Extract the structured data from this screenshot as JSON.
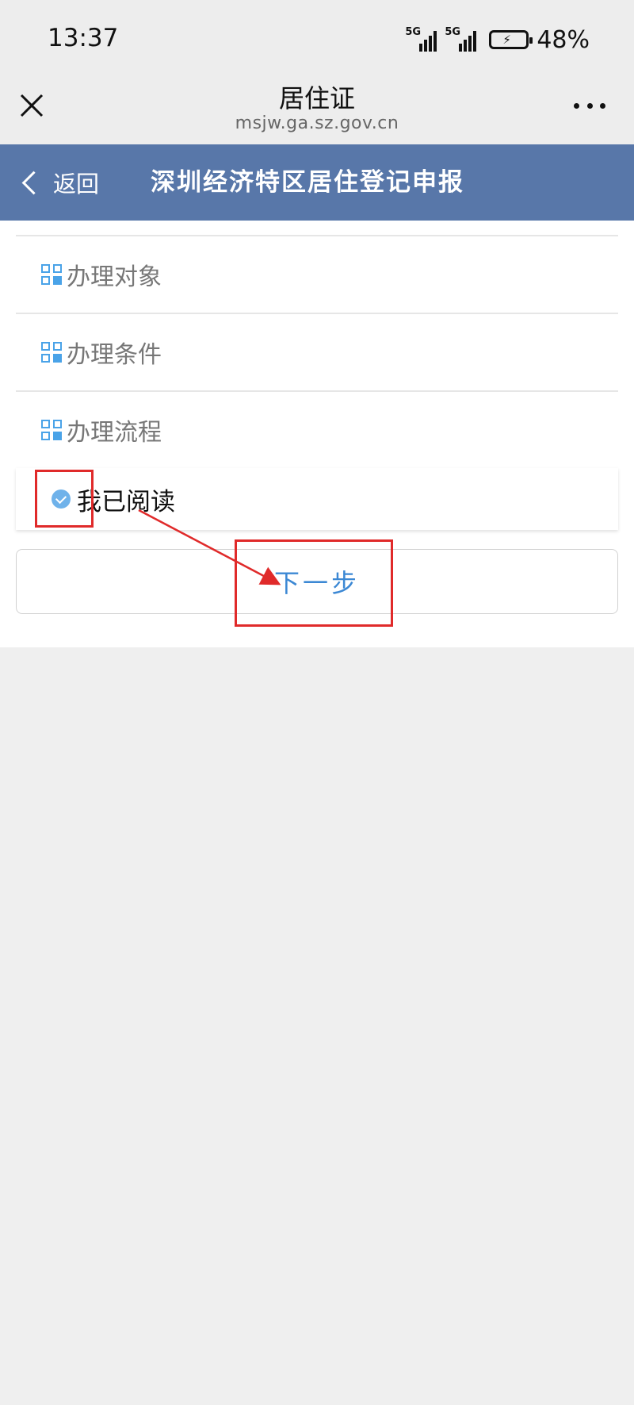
{
  "status_bar": {
    "time": "13:37",
    "signal1_label": "5G",
    "signal2_label": "5G",
    "battery_percent": "48%"
  },
  "title_bar": {
    "title": "居住证",
    "subtitle": "msjw.ga.sz.gov.cn"
  },
  "header": {
    "back_label": "返回",
    "title": "深圳经济特区居住登记申报"
  },
  "sections": [
    {
      "label": "办理对象"
    },
    {
      "label": "办理条件"
    },
    {
      "label": "办理流程"
    }
  ],
  "agreement": {
    "label": "我已阅读",
    "checked": true
  },
  "next_button": {
    "label": "下一步"
  },
  "colors": {
    "header_blue": "#5877a9",
    "accent_blue": "#3c88d4",
    "annotation_red": "#e02a2a"
  }
}
